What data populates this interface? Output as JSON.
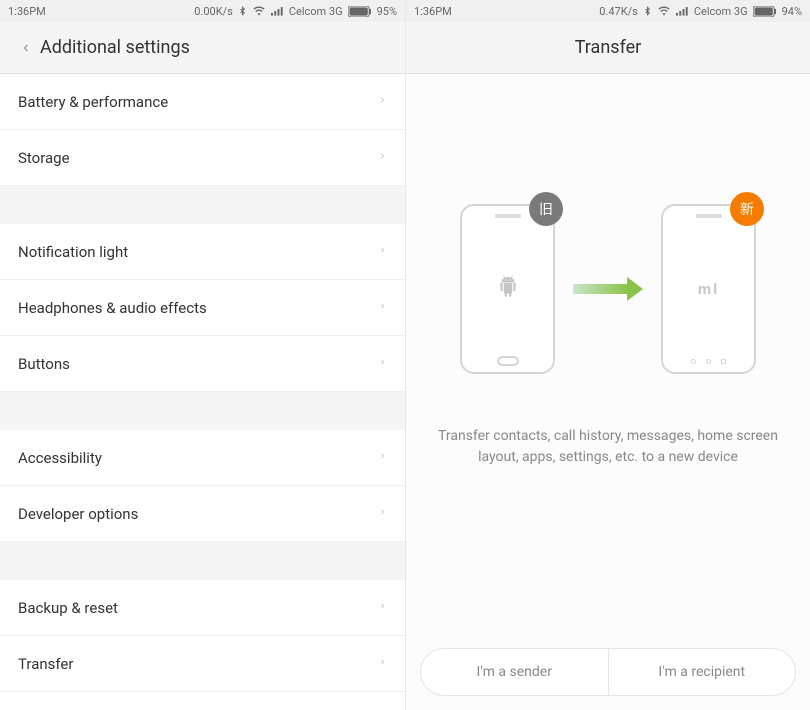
{
  "left": {
    "status": {
      "time": "1:36PM",
      "speed": "0.00K/s",
      "carrier": "Celcom 3G",
      "battery": "95%"
    },
    "header": {
      "title": "Additional settings"
    },
    "groups": [
      [
        "Battery & performance",
        "Storage"
      ],
      [
        "Notification light",
        "Headphones & audio effects",
        "Buttons"
      ],
      [
        "Accessibility",
        "Developer options"
      ],
      [
        "Backup & reset",
        "Transfer"
      ]
    ]
  },
  "right": {
    "status": {
      "time": "1:36PM",
      "speed": "0.47K/s",
      "carrier": "Celcom 3G",
      "battery": "94%"
    },
    "header": {
      "title": "Transfer"
    },
    "badges": {
      "old": "旧",
      "new": "新"
    },
    "description": "Transfer contacts, call history, messages, home screen layout, apps, settings, etc. to a new device",
    "buttons": {
      "sender": "I'm a sender",
      "recipient": "I'm a recipient"
    }
  }
}
